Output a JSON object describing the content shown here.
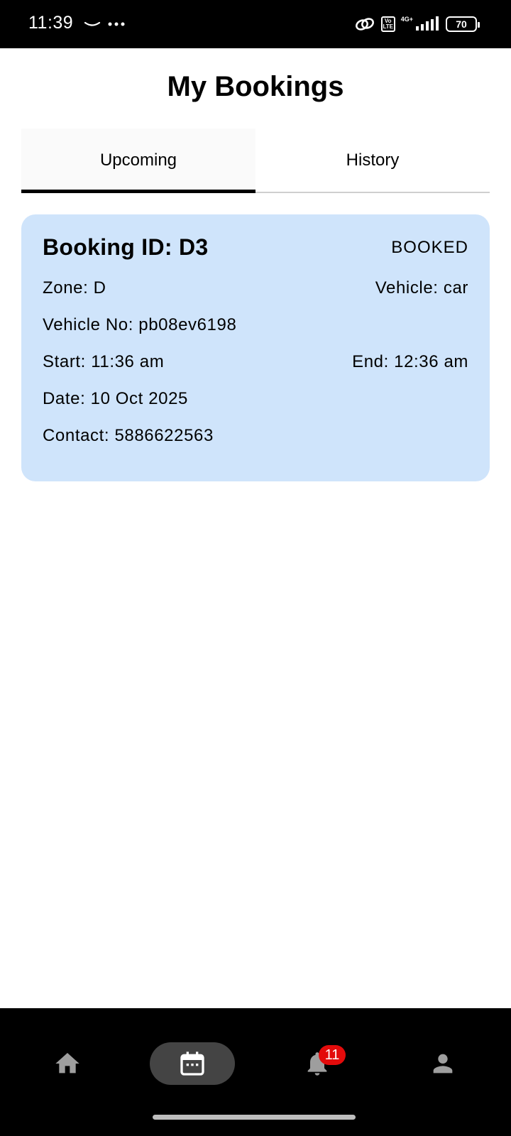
{
  "status_bar": {
    "time": "11:39",
    "network": "4G+",
    "volte": "Vo LTE",
    "battery": "70"
  },
  "header": {
    "title": "My Bookings"
  },
  "tabs": [
    {
      "label": "Upcoming",
      "active": true
    },
    {
      "label": "History",
      "active": false
    }
  ],
  "booking": {
    "id_label": "Booking ID: D3",
    "status": "BOOKED",
    "zone": "Zone: D",
    "vehicle": "Vehicle: car",
    "vehicle_no": "Vehicle No: pb08ev6198",
    "start": "Start: 11:36 am",
    "end": "End: 12:36 am",
    "date": "Date: 10 Oct 2025",
    "contact": "Contact: 5886622563"
  },
  "bottom_nav": {
    "items": [
      {
        "name": "home",
        "icon": "home-icon",
        "active": false
      },
      {
        "name": "bookings",
        "icon": "calendar-icon",
        "active": true
      },
      {
        "name": "notifications",
        "icon": "bell-icon",
        "active": false,
        "badge": "11"
      },
      {
        "name": "profile",
        "icon": "person-icon",
        "active": false
      }
    ]
  },
  "colors": {
    "card_bg": "#cfe4fb",
    "badge_red": "#e30b0b",
    "nav_icon": "#9e9e9e"
  }
}
